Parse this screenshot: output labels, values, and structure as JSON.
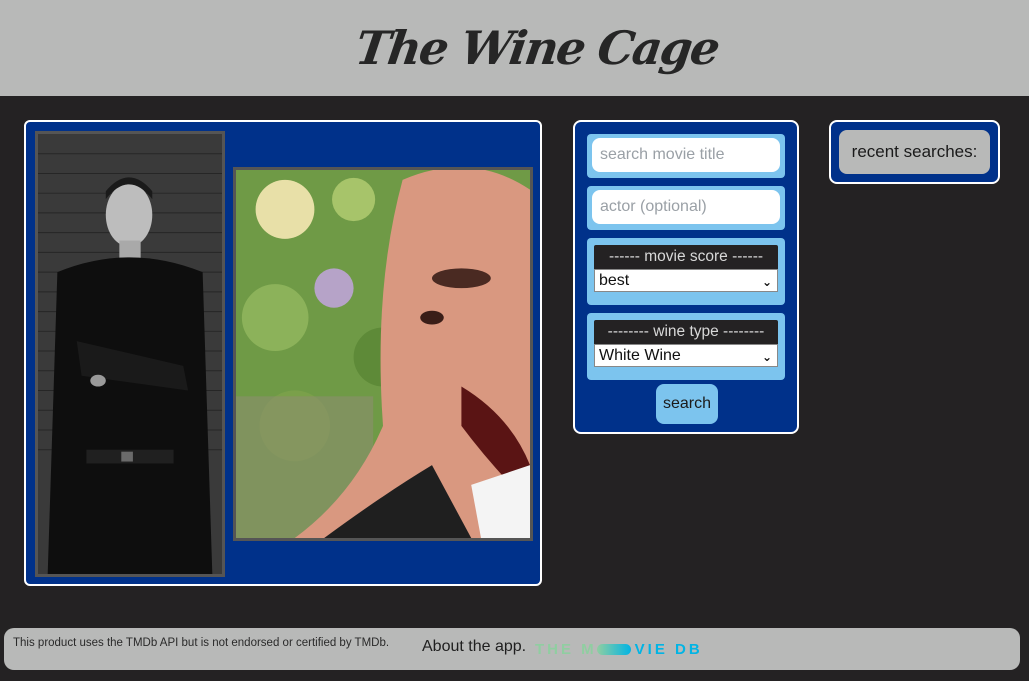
{
  "header": {
    "logo_text": "The Wine Cage"
  },
  "photos": {
    "left_alt": "black and white portrait",
    "right_alt": "color photo close-up"
  },
  "search": {
    "title_placeholder": "search movie title",
    "actor_placeholder": "actor (optional)",
    "score": {
      "label": "------ movie score ------",
      "selected": "best"
    },
    "wine": {
      "label": "-------- wine type --------",
      "selected": "White Wine"
    },
    "button_label": "search"
  },
  "recent": {
    "label": "recent searches:"
  },
  "footer": {
    "disclaimer": "This product uses the TMDb API but is not endorsed or certified by TMDb.",
    "about": "About the app.",
    "tmdb_left": "THE M",
    "tmdb_right": "VIE DB"
  },
  "colors": {
    "page_bg": "#242223",
    "header_bg": "#b8b9b8",
    "panel_bg": "#00318a",
    "field_bg": "#7cc4ee",
    "tmdb_green": "#90cea1",
    "tmdb_blue": "#01b4e4"
  }
}
